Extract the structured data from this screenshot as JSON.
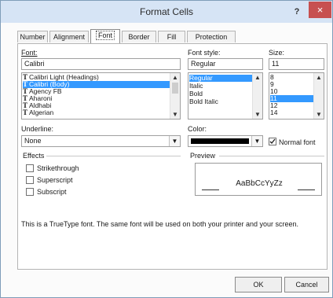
{
  "window": {
    "title": "Format Cells",
    "help": "?",
    "close": "×"
  },
  "tabs": [
    "Number",
    "Alignment",
    "Font",
    "Border",
    "Fill",
    "Protection"
  ],
  "font": {
    "label": "Font:",
    "value": "Calibri",
    "items": [
      "Calibri Light (Headings)",
      "Calibri (Body)",
      "Agency FB",
      "Aharoni",
      "Aldhabi",
      "Algerian"
    ],
    "selected_index": 1
  },
  "font_style": {
    "label": "Font style:",
    "value": "Regular",
    "items": [
      "Regular",
      "Italic",
      "Bold",
      "Bold Italic"
    ],
    "selected_index": 0
  },
  "size": {
    "label": "Size:",
    "value": "11",
    "items": [
      "8",
      "9",
      "10",
      "11",
      "12",
      "14"
    ],
    "selected_index": 3
  },
  "underline": {
    "label": "Underline:",
    "value": "None"
  },
  "color": {
    "label": "Color:",
    "swatch": "#000000",
    "normal_font_label": "Normal font",
    "normal_font_checked": true
  },
  "effects": {
    "label": "Effects",
    "items": [
      "Strikethrough",
      "Superscript",
      "Subscript"
    ]
  },
  "preview": {
    "label": "Preview",
    "sample": "AaBbCcYyZz"
  },
  "info_text": "This is a TrueType font.  The same font will be used on both your printer and your screen.",
  "buttons": {
    "ok": "OK",
    "cancel": "Cancel"
  },
  "colors": {
    "titlebar": "#d6e4f5",
    "close": "#c75050",
    "selection": "#3399ff"
  }
}
